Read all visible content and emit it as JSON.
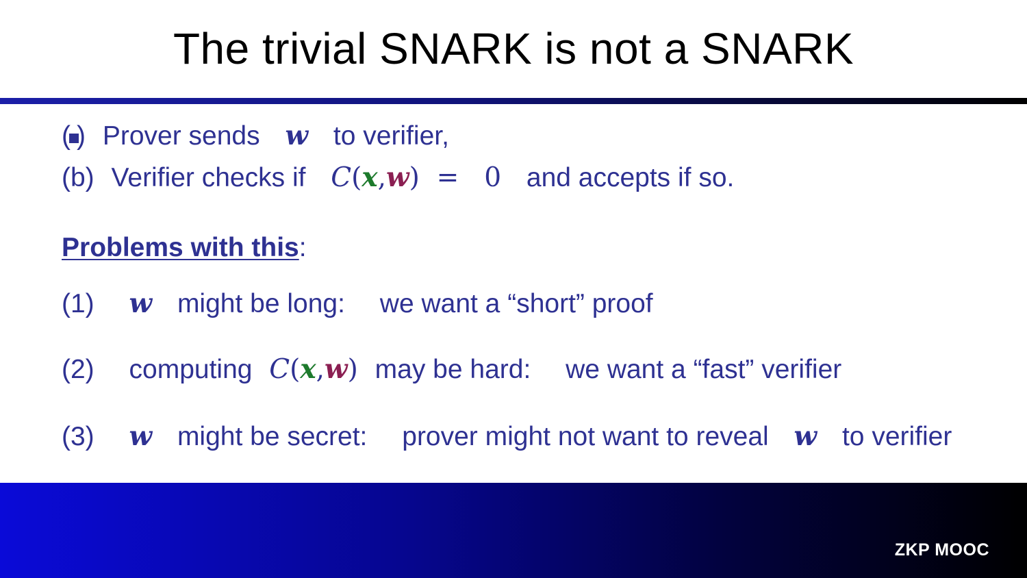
{
  "slide": {
    "title": "The trivial SNARK is not a SNARK",
    "steps": [
      {
        "label_open": "(",
        "label_close": ")",
        "text_before": "Prover sends",
        "var_w": "w",
        "text_after": "to verifier,"
      },
      {
        "label": "(b)",
        "text_before": "Verifier checks if",
        "func": "C",
        "paren_open": "(",
        "var_x": "x",
        "comma": ",",
        "var_w": "w",
        "paren_close": ")",
        "equals": "=",
        "zero": "0",
        "text_after": "and accepts if so."
      }
    ],
    "problems_heading": "Problems with this",
    "problems_colon": ":",
    "problems": [
      {
        "label": "(1)",
        "var_w": "w",
        "text_1": "might be long:",
        "text_2": "we want a “short” proof"
      },
      {
        "label": "(2)",
        "text_pre": "computing",
        "func": "C",
        "paren_open": "(",
        "var_x": "x",
        "comma": ",",
        "var_w": "w",
        "paren_close": ")",
        "text_1": "may be hard:",
        "text_2": "we want a “fast” verifier"
      },
      {
        "label": "(3)",
        "var_w": "w",
        "text_1": "might be secret:",
        "text_2": "prover might not want to reveal",
        "var_w2": "w",
        "text_3": "to verifier"
      }
    ],
    "footer_text": "ZKP MOOC"
  },
  "colors": {
    "body_text": "#2e3192",
    "var_x": "#1d7a2c",
    "var_w": "#8b1f52",
    "footer_start": "#0a0ad8",
    "footer_end": "#000000"
  },
  "icons": {
    "step_a_marker": "square-bullet-icon"
  }
}
